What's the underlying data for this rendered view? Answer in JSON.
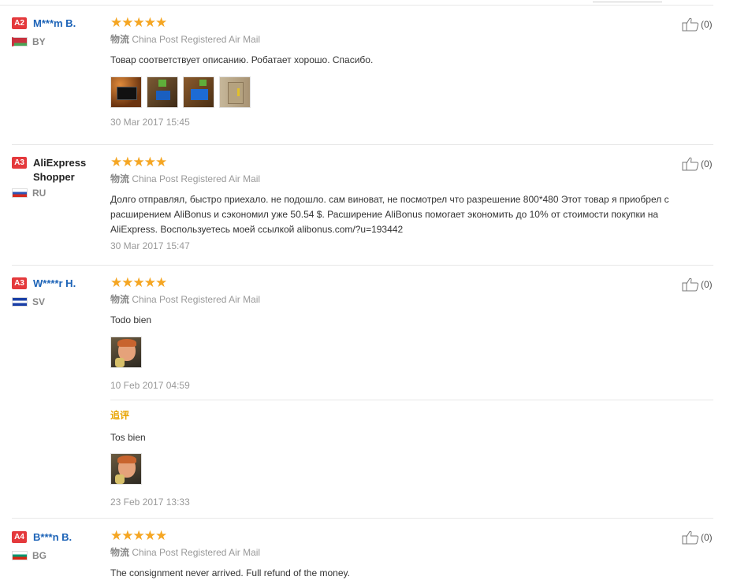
{
  "reviews": [
    {
      "level": "A2",
      "name": "M***m B.",
      "country": "BY",
      "stars": "★★★★★",
      "wuliu": "物流",
      "shipping": "China Post Registered Air Mail",
      "text": "Товар соответствует описанию. Робатает хорошо. Спасибо.",
      "date": "30 Mar 2017 15:45",
      "likes": "(0)"
    },
    {
      "level": "A3",
      "name": "AliExpress Shopper",
      "country": "RU",
      "stars": "★★★★★",
      "wuliu": "物流",
      "shipping": "China Post Registered Air Mail",
      "text": "Долго отправлял, быстро приехало. не подошло. сам виноват, не посмотрел что разрешение 800*480 Этот товар я приобрел с расширением AliBonus и сэкономил уже 50.54 $. Расширение AliBonus помогает экономить до 10% от стоимости покупки на AliExpress. Воспользуетесь моей ссылкой alibonus.com/?u=193442",
      "date": "30 Mar 2017 15:47",
      "likes": "(0)"
    },
    {
      "level": "A3",
      "name": "W****r H.",
      "country": "SV",
      "stars": "★★★★★",
      "wuliu": "物流",
      "shipping": "China Post Registered Air Mail",
      "text": "Todo bien",
      "date": "10 Feb 2017 04:59",
      "likes": "(0)",
      "followup": {
        "label": "追评",
        "text": "Tos bien",
        "date": "23 Feb 2017 13:33"
      }
    },
    {
      "level": "A4",
      "name": "B***n B.",
      "country": "BG",
      "stars": "★★★★★",
      "wuliu": "物流",
      "shipping": "China Post Registered Air Mail",
      "text": "The consignment never arrived. Full refund of the money.",
      "likes": "(0)"
    }
  ],
  "colors": {
    "accent_name": "#1c63b7",
    "level_badge": "#e4393c",
    "stars": "#f5a623",
    "followup_label": "#e8a400"
  },
  "icons": [
    "thumbs-up-icon",
    "star-icon"
  ]
}
